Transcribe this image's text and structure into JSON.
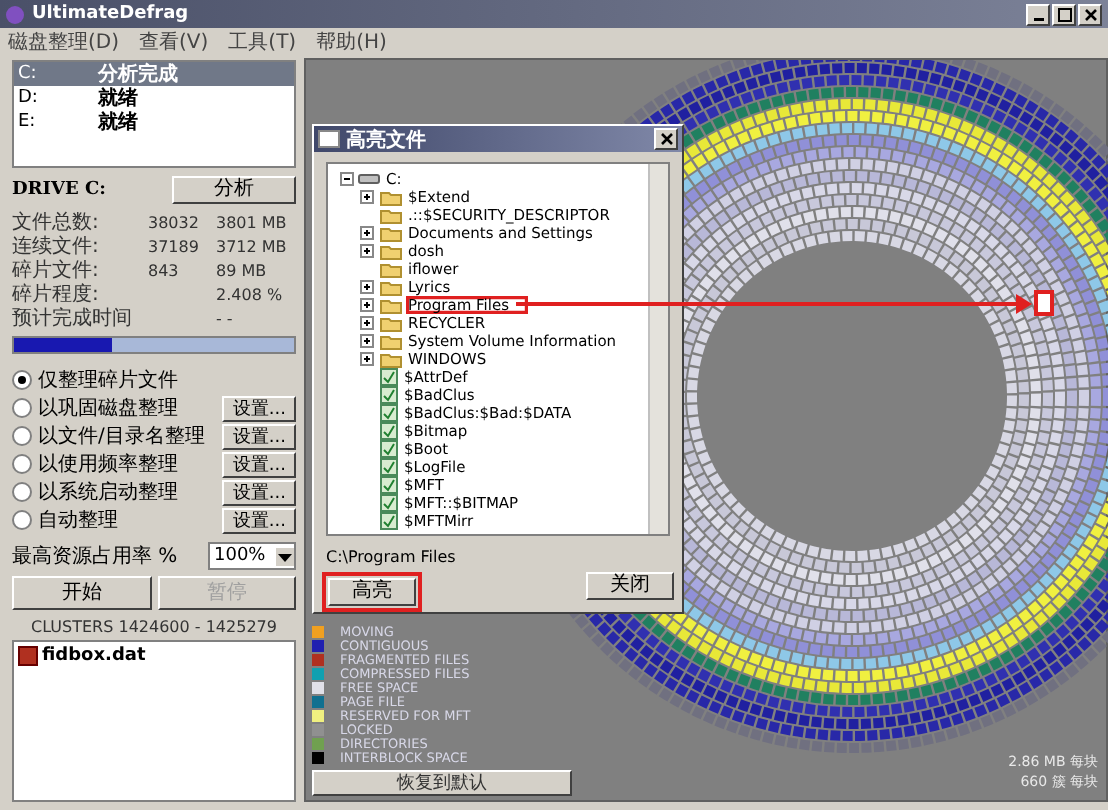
{
  "window": {
    "title": "UltimateDefrag"
  },
  "menu": [
    "磁盘整理(D)",
    "查看(V)",
    "工具(T)",
    "帮助(H)"
  ],
  "drives": [
    {
      "letter": "C:",
      "status": "分析完成",
      "selected": true
    },
    {
      "letter": "D:",
      "status": "就绪",
      "selected": false
    },
    {
      "letter": "E:",
      "status": "就绪",
      "selected": false
    }
  ],
  "drive_info": {
    "label": "DRIVE C:",
    "analyze_button": "分析",
    "stats": [
      {
        "label": "文件总数:",
        "count": "38032",
        "size": "3801 MB"
      },
      {
        "label": "连续文件:",
        "count": "37189",
        "size": "3712 MB"
      },
      {
        "label": "碎片文件:",
        "count": "843",
        "size": "89 MB"
      },
      {
        "label": "碎片程度:",
        "size": "2.408 %"
      },
      {
        "label": "预计完成时间",
        "size": "- -"
      }
    ],
    "progress": {
      "level": 0.35
    }
  },
  "options": [
    {
      "label": "仅整理碎片文件",
      "selected": true
    },
    {
      "label": "以巩固磁盘整理",
      "selected": false,
      "settings": "设置..."
    },
    {
      "label": "以文件/目录名整理",
      "selected": false,
      "settings": "设置..."
    },
    {
      "label": "以使用频率整理",
      "selected": false,
      "settings": "设置..."
    },
    {
      "label": "以系统启动整理",
      "selected": false,
      "settings": "设置..."
    },
    {
      "label": "自动整理",
      "selected": false,
      "settings": "设置..."
    }
  ],
  "resource": {
    "label": "最高资源占用率 %",
    "value": "100%"
  },
  "actions": [
    {
      "label": "开始",
      "disabled": false
    },
    {
      "label": "暂停",
      "disabled": true
    }
  ],
  "clusters": "CLUSTERS 1424600 - 1425279",
  "files": [
    {
      "name": "fidbox.dat",
      "color": "#b03020"
    }
  ],
  "legend": [
    {
      "label": "MOVING",
      "color": "#f0a020"
    },
    {
      "label": "CONTIGUOUS",
      "color": "#2020b0"
    },
    {
      "label": "FRAGMENTED FILES",
      "color": "#b03020"
    },
    {
      "label": "COMPRESSED FILES",
      "color": "#10a0b0"
    },
    {
      "label": "FREE SPACE",
      "color": "#e0e0e8"
    },
    {
      "label": "PAGE FILE",
      "color": "#107090"
    },
    {
      "label": "RESERVED FOR MFT",
      "color": "#f0f080"
    },
    {
      "label": "LOCKED",
      "color": "#909090"
    },
    {
      "label": "DIRECTORIES",
      "color": "#70a050"
    },
    {
      "label": "INTERBLOCK SPACE",
      "color": "#000000"
    }
  ],
  "restore_button": "恢复到默认",
  "block_info": [
    "2.86 MB 每块",
    "660 簇 每块"
  ],
  "dialog": {
    "title": "高亮文件",
    "tree": {
      "name": "C:",
      "expanded": true,
      "children": [
        {
          "name": "$Extend",
          "kind": "folder",
          "expandable": true,
          "annotated": false
        },
        {
          "name": ".::$SECURITY_DESCRIPTOR",
          "kind": "folder",
          "expandable": false,
          "annotated": false
        },
        {
          "name": "Documents and Settings",
          "kind": "folder",
          "expandable": true,
          "annotated": false
        },
        {
          "name": "dosh",
          "kind": "folder",
          "expandable": true,
          "annotated": false
        },
        {
          "name": "iflower",
          "kind": "folder",
          "expandable": false,
          "annotated": false
        },
        {
          "name": "Lyrics",
          "kind": "folder",
          "expandable": true,
          "annotated": false
        },
        {
          "name": "Program Files",
          "kind": "folder",
          "expandable": true,
          "annotated": true
        },
        {
          "name": "RECYCLER",
          "kind": "folder",
          "expandable": true,
          "annotated": false
        },
        {
          "name": "System Volume Information",
          "kind": "folder",
          "expandable": true,
          "annotated": false
        },
        {
          "name": "WINDOWS",
          "kind": "folder",
          "expandable": true,
          "annotated": false
        },
        {
          "name": "$AttrDef",
          "kind": "file",
          "expandable": false,
          "annotated": false
        },
        {
          "name": "$BadClus",
          "kind": "file",
          "expandable": false,
          "annotated": false
        },
        {
          "name": "$BadClus:$Bad:$DATA",
          "kind": "file",
          "expandable": false,
          "annotated": false
        },
        {
          "name": "$Bitmap",
          "kind": "file",
          "expandable": false,
          "annotated": false
        },
        {
          "name": "$Boot",
          "kind": "file",
          "expandable": false,
          "annotated": false
        },
        {
          "name": "$LogFile",
          "kind": "file",
          "expandable": false,
          "annotated": false
        },
        {
          "name": "$MFT",
          "kind": "file",
          "expandable": false,
          "annotated": false
        },
        {
          "name": "$MFT::$BITMAP",
          "kind": "file",
          "expandable": false,
          "annotated": false
        },
        {
          "name": "$MFTMirr",
          "kind": "file",
          "expandable": false,
          "annotated": false
        }
      ]
    },
    "path": "C:\\Program Files",
    "buttons": [
      {
        "label": "高亮",
        "annotated": true
      },
      {
        "label": "关闭",
        "annotated": false
      }
    ]
  }
}
